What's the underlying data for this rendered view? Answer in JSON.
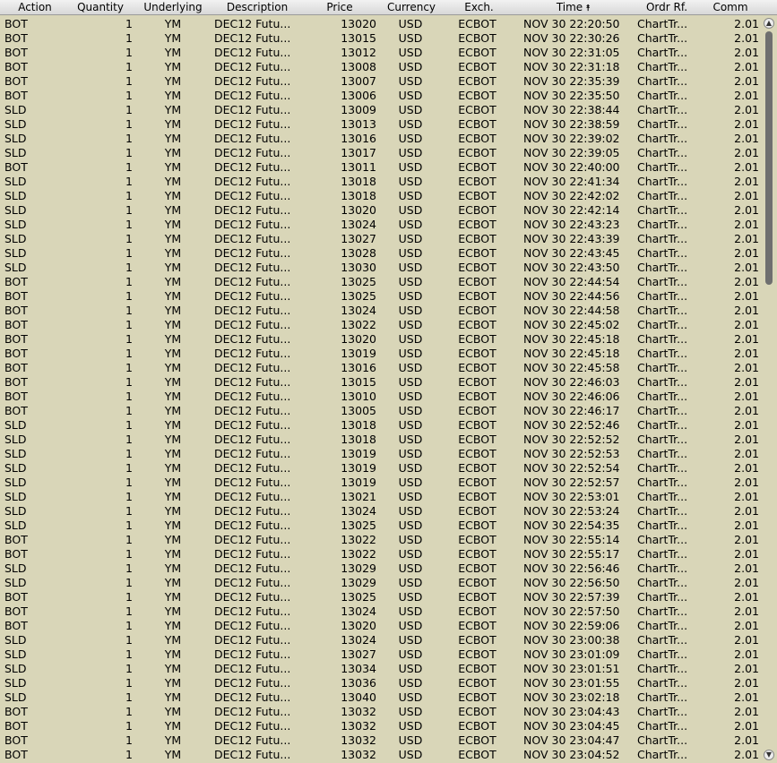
{
  "columns": [
    {
      "key": "action",
      "label": "Action"
    },
    {
      "key": "qty",
      "label": "Quantity"
    },
    {
      "key": "und",
      "label": "Underlying"
    },
    {
      "key": "desc",
      "label": "Description"
    },
    {
      "key": "price",
      "label": "Price"
    },
    {
      "key": "cur",
      "label": "Currency"
    },
    {
      "key": "exch",
      "label": "Exch."
    },
    {
      "key": "time",
      "label": "Time",
      "sort_indicator": "⯭"
    },
    {
      "key": "ref",
      "label": "Ordr Rf."
    },
    {
      "key": "comm",
      "label": "Comm"
    }
  ],
  "common": {
    "qty": "1",
    "und": "YM",
    "desc": "DEC12 Futu...",
    "cur": "USD",
    "exch": "ECBOT",
    "ref": "ChartTr...",
    "comm": "2.01"
  },
  "rows": [
    {
      "action": "BOT",
      "price": "13020",
      "time": "NOV 30 22:20:50"
    },
    {
      "action": "BOT",
      "price": "13015",
      "time": "NOV 30 22:30:26"
    },
    {
      "action": "BOT",
      "price": "13012",
      "time": "NOV 30 22:31:05"
    },
    {
      "action": "BOT",
      "price": "13008",
      "time": "NOV 30 22:31:18"
    },
    {
      "action": "BOT",
      "price": "13007",
      "time": "NOV 30 22:35:39"
    },
    {
      "action": "BOT",
      "price": "13006",
      "time": "NOV 30 22:35:50"
    },
    {
      "action": "SLD",
      "price": "13009",
      "time": "NOV 30 22:38:44"
    },
    {
      "action": "SLD",
      "price": "13013",
      "time": "NOV 30 22:38:59"
    },
    {
      "action": "SLD",
      "price": "13016",
      "time": "NOV 30 22:39:02"
    },
    {
      "action": "SLD",
      "price": "13017",
      "time": "NOV 30 22:39:05"
    },
    {
      "action": "BOT",
      "price": "13011",
      "time": "NOV 30 22:40:00"
    },
    {
      "action": "SLD",
      "price": "13018",
      "time": "NOV 30 22:41:34"
    },
    {
      "action": "SLD",
      "price": "13018",
      "time": "NOV 30 22:42:02"
    },
    {
      "action": "SLD",
      "price": "13020",
      "time": "NOV 30 22:42:14"
    },
    {
      "action": "SLD",
      "price": "13024",
      "time": "NOV 30 22:43:23"
    },
    {
      "action": "SLD",
      "price": "13027",
      "time": "NOV 30 22:43:39"
    },
    {
      "action": "SLD",
      "price": "13028",
      "time": "NOV 30 22:43:45"
    },
    {
      "action": "SLD",
      "price": "13030",
      "time": "NOV 30 22:43:50"
    },
    {
      "action": "BOT",
      "price": "13025",
      "time": "NOV 30 22:44:54"
    },
    {
      "action": "BOT",
      "price": "13025",
      "time": "NOV 30 22:44:56"
    },
    {
      "action": "BOT",
      "price": "13024",
      "time": "NOV 30 22:44:58"
    },
    {
      "action": "BOT",
      "price": "13022",
      "time": "NOV 30 22:45:02"
    },
    {
      "action": "BOT",
      "price": "13020",
      "time": "NOV 30 22:45:18"
    },
    {
      "action": "BOT",
      "price": "13019",
      "time": "NOV 30 22:45:18"
    },
    {
      "action": "BOT",
      "price": "13016",
      "time": "NOV 30 22:45:58"
    },
    {
      "action": "BOT",
      "price": "13015",
      "time": "NOV 30 22:46:03"
    },
    {
      "action": "BOT",
      "price": "13010",
      "time": "NOV 30 22:46:06"
    },
    {
      "action": "BOT",
      "price": "13005",
      "time": "NOV 30 22:46:17"
    },
    {
      "action": "SLD",
      "price": "13018",
      "time": "NOV 30 22:52:46"
    },
    {
      "action": "SLD",
      "price": "13018",
      "time": "NOV 30 22:52:52"
    },
    {
      "action": "SLD",
      "price": "13019",
      "time": "NOV 30 22:52:53"
    },
    {
      "action": "SLD",
      "price": "13019",
      "time": "NOV 30 22:52:54"
    },
    {
      "action": "SLD",
      "price": "13019",
      "time": "NOV 30 22:52:57"
    },
    {
      "action": "SLD",
      "price": "13021",
      "time": "NOV 30 22:53:01"
    },
    {
      "action": "SLD",
      "price": "13024",
      "time": "NOV 30 22:53:24"
    },
    {
      "action": "SLD",
      "price": "13025",
      "time": "NOV 30 22:54:35"
    },
    {
      "action": "BOT",
      "price": "13022",
      "time": "NOV 30 22:55:14"
    },
    {
      "action": "BOT",
      "price": "13022",
      "time": "NOV 30 22:55:17"
    },
    {
      "action": "SLD",
      "price": "13029",
      "time": "NOV 30 22:56:46"
    },
    {
      "action": "SLD",
      "price": "13029",
      "time": "NOV 30 22:56:50"
    },
    {
      "action": "BOT",
      "price": "13025",
      "time": "NOV 30 22:57:39"
    },
    {
      "action": "BOT",
      "price": "13024",
      "time": "NOV 30 22:57:50"
    },
    {
      "action": "BOT",
      "price": "13020",
      "time": "NOV 30 22:59:06"
    },
    {
      "action": "SLD",
      "price": "13024",
      "time": "NOV 30 23:00:38"
    },
    {
      "action": "SLD",
      "price": "13027",
      "time": "NOV 30 23:01:09"
    },
    {
      "action": "SLD",
      "price": "13034",
      "time": "NOV 30 23:01:51"
    },
    {
      "action": "SLD",
      "price": "13036",
      "time": "NOV 30 23:01:55"
    },
    {
      "action": "SLD",
      "price": "13040",
      "time": "NOV 30 23:02:18"
    },
    {
      "action": "BOT",
      "price": "13032",
      "time": "NOV 30 23:04:43"
    },
    {
      "action": "BOT",
      "price": "13032",
      "time": "NOV 30 23:04:45"
    },
    {
      "action": "BOT",
      "price": "13032",
      "time": "NOV 30 23:04:47"
    },
    {
      "action": "BOT",
      "price": "13032",
      "time": "NOV 30 23:04:52"
    }
  ],
  "scrollbar": {
    "up_icon": "▲",
    "down_icon": "▼"
  }
}
